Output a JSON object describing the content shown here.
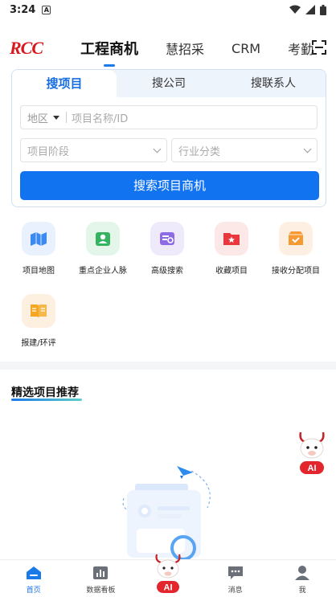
{
  "status_bar": {
    "time": "3:24",
    "sim_badge": "A"
  },
  "top_nav": {
    "logo": "RCC",
    "tabs": [
      "工程商机",
      "慧招采",
      "CRM",
      "考勤"
    ]
  },
  "search": {
    "tabs": [
      "搜项目",
      "搜公司",
      "搜联系人"
    ],
    "region_label": "地区",
    "name_placeholder": "项目名称/ID",
    "stage_placeholder": "项目阶段",
    "industry_placeholder": "行业分类",
    "button_label": "搜索项目商机"
  },
  "features": [
    {
      "label": "项目地图",
      "icon": "map-icon"
    },
    {
      "label": "重点企业人脉",
      "icon": "contacts-icon"
    },
    {
      "label": "高级搜索",
      "icon": "advanced-search-icon"
    },
    {
      "label": "收藏项目",
      "icon": "favorite-folder-icon"
    },
    {
      "label": "接收分配项目",
      "icon": "inbox-check-icon"
    },
    {
      "label": "报建/环评",
      "icon": "book-icon"
    }
  ],
  "recommend": {
    "title": "精选项目推荐"
  },
  "ai": {
    "badge": "AI"
  },
  "bottom_nav": {
    "items": [
      "首页",
      "数据看板",
      "消息",
      "我"
    ]
  },
  "colors": {
    "accent": "#1273f0",
    "brand": "#d7191e"
  }
}
